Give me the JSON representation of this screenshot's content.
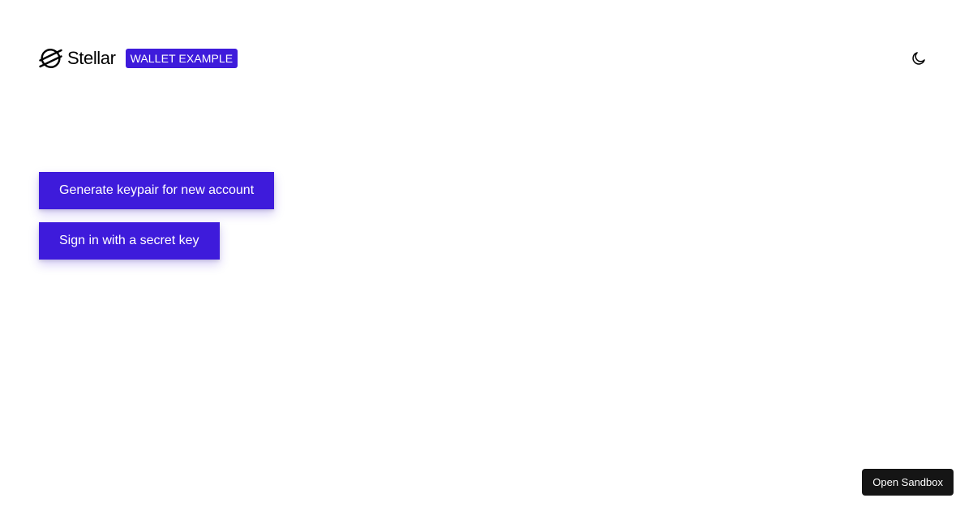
{
  "header": {
    "logo_text": "Stellar",
    "logo_icon": "stellar-logo-icon",
    "badge": "WALLET EXAMPLE",
    "theme_toggle_icon": "moon-icon"
  },
  "actions": {
    "generate_label": "Generate keypair for new account",
    "signin_label": "Sign in with a secret key"
  },
  "sandbox": {
    "label": "Open Sandbox"
  },
  "colors": {
    "accent": "#3e1bdb",
    "sandbox_bg": "#151515",
    "background": "#ffffff"
  }
}
